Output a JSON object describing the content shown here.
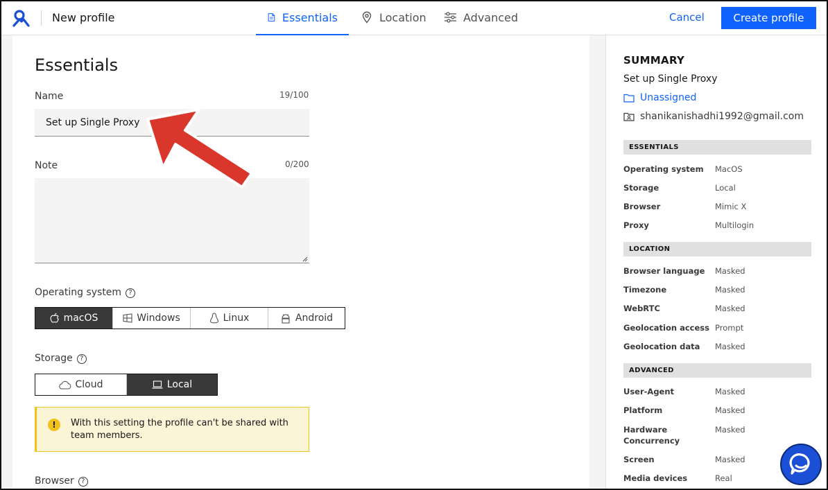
{
  "header": {
    "title": "New profile",
    "tabs": [
      {
        "label": "Essentials",
        "icon": "document-icon"
      },
      {
        "label": "Location",
        "icon": "location-pin-icon"
      },
      {
        "label": "Advanced",
        "icon": "sliders-icon"
      }
    ],
    "cancel_label": "Cancel",
    "create_label": "Create profile"
  },
  "form": {
    "section_title": "Essentials",
    "name_label": "Name",
    "name_counter": "19/100",
    "name_value": "Set up Single Proxy",
    "note_label": "Note",
    "note_counter": "0/200",
    "os_label": "Operating system",
    "os_options": [
      "macOS",
      "Windows",
      "Linux",
      "Android"
    ],
    "os_selected": "macOS",
    "storage_label": "Storage",
    "storage_options": [
      "Cloud",
      "Local"
    ],
    "storage_selected": "Local",
    "warning_text": "With this setting the profile can't be shared with team members.",
    "browser_label": "Browser",
    "help_glyph": "?"
  },
  "summary": {
    "title": "SUMMARY",
    "profile_name": "Set up Single Proxy",
    "folder": "Unassigned",
    "email": "shanikanishadhi1992@gmail.com",
    "essentials": {
      "heading": "ESSENTIALS",
      "rows": [
        {
          "key": "Operating system",
          "value": "MacOS"
        },
        {
          "key": "Storage",
          "value": "Local"
        },
        {
          "key": "Browser",
          "value": "Mimic X"
        },
        {
          "key": "Proxy",
          "value": "Multilogin"
        }
      ]
    },
    "location": {
      "heading": "LOCATION",
      "rows": [
        {
          "key": "Browser language",
          "value": "Masked"
        },
        {
          "key": "Timezone",
          "value": "Masked"
        },
        {
          "key": "WebRTC",
          "value": "Masked"
        },
        {
          "key": "Geolocation access",
          "value": "Prompt"
        },
        {
          "key": "Geolocation data",
          "value": "Masked"
        }
      ]
    },
    "advanced": {
      "heading": "ADVANCED",
      "rows": [
        {
          "key": "User-Agent",
          "value": "Masked"
        },
        {
          "key": "Platform",
          "value": "Masked"
        },
        {
          "key": "Hardware Concurrency",
          "value": "Masked"
        },
        {
          "key": "Screen",
          "value": "Masked"
        },
        {
          "key": "Media devices",
          "value": "Real"
        }
      ]
    }
  },
  "colors": {
    "accent": "#0f62fe",
    "selected_segment": "#393939",
    "warning_bg": "#fcf4d6",
    "warning_border": "#f1c21b",
    "annotation_arrow": "#d9372b",
    "chat_bubble": "#1a4fd6"
  }
}
